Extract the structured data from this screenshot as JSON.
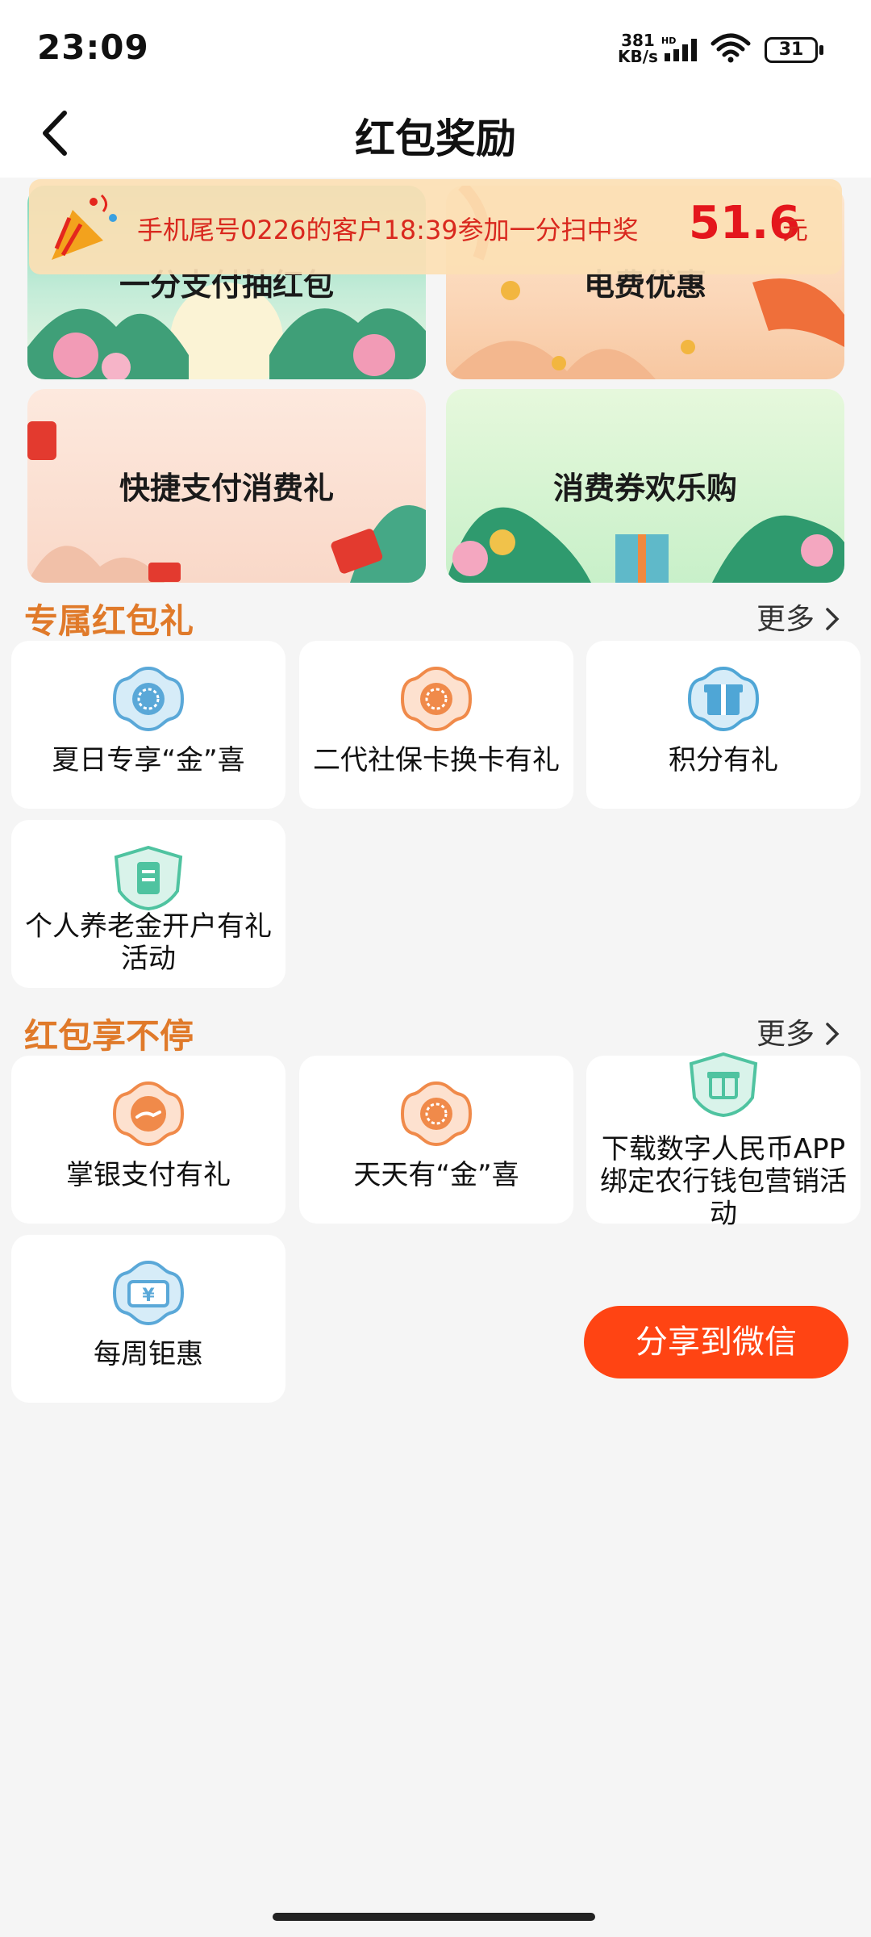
{
  "status": {
    "time": "23:09",
    "speed_value": "381",
    "speed_unit": "KB/s",
    "network": "HD",
    "battery": "31"
  },
  "header": {
    "title": "红包奖励"
  },
  "banners": [
    {
      "label": "一分支付抽红包"
    },
    {
      "label": "电费优惠"
    },
    {
      "label": "快捷支付消费礼"
    },
    {
      "label": "消费券欢乐购"
    }
  ],
  "ticker": {
    "prefix": "手机尾号0226的客户18:39参加一分扫中奖",
    "amount": "51.6",
    "unit": "元"
  },
  "sections": [
    {
      "title": "专属红包礼",
      "more": "更多",
      "items": [
        {
          "label": "夏日专享“金”喜",
          "icon": "sun-wheel-icon",
          "color": "#5aa8d8"
        },
        {
          "label": "二代社保卡换卡有礼",
          "icon": "sun-wheel-icon",
          "color": "#f08a4a"
        },
        {
          "label": "积分有礼",
          "icon": "gift-icon",
          "color": "#4fa6d6"
        },
        {
          "label": "个人养老金开户有礼活动",
          "line1": "个人养老金开户有礼",
          "line2": "活动",
          "icon": "pension-card-icon",
          "color": "#4fc3a0"
        }
      ]
    },
    {
      "title": "红包享不停",
      "more": "更多",
      "items": [
        {
          "label": "掌银支付有礼",
          "icon": "pay-hand-icon",
          "color": "#f08a4a"
        },
        {
          "label": "天天有“金”喜",
          "icon": "sun-wheel-icon",
          "color": "#f08a4a"
        },
        {
          "label": "下载数字人民币APP绑定农行钱包营销活动",
          "line1": "下载数字人民币APP",
          "line2": "绑定农行钱包营销活",
          "line3": "动",
          "icon": "gift-shield-icon",
          "color": "#4fc3a0"
        },
        {
          "label": "每周钜惠",
          "icon": "yuan-ticket-icon",
          "color": "#5aa8d8"
        }
      ]
    }
  ],
  "share_button": "分享到微信"
}
